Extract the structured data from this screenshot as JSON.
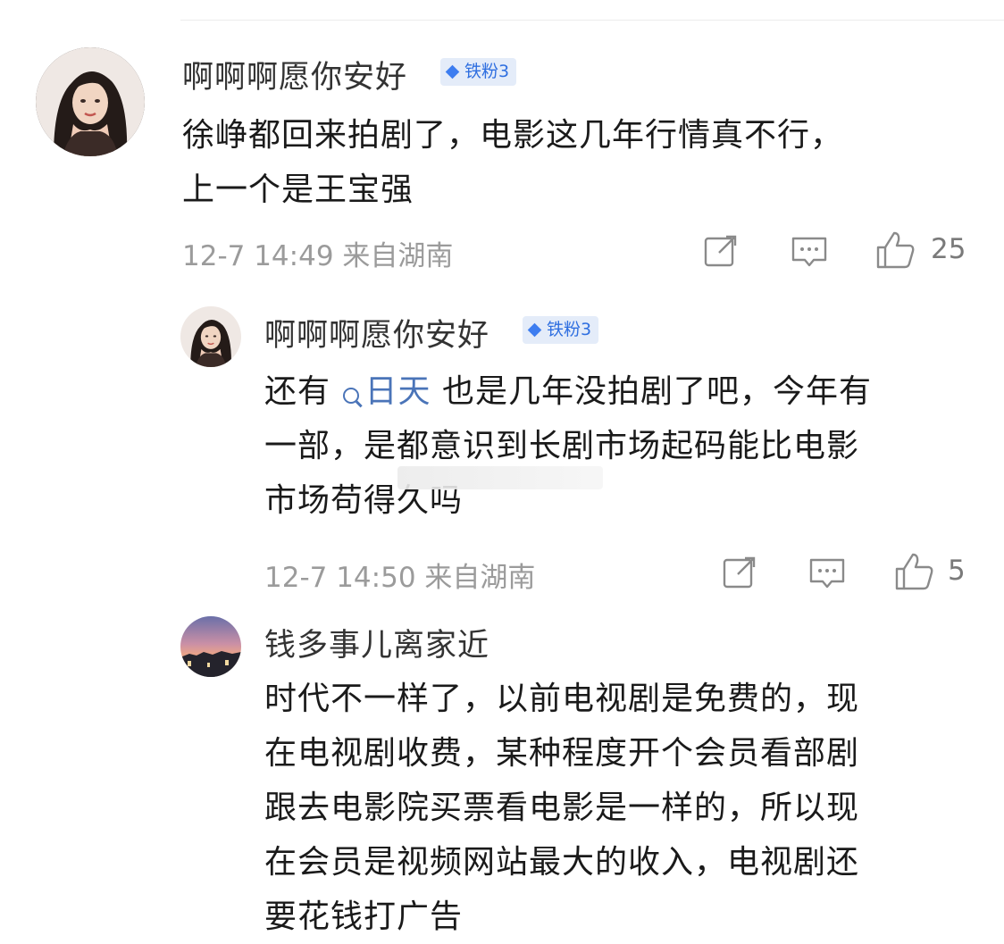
{
  "comments": [
    {
      "username": "啊啊啊愿你安好",
      "badge": "铁粉3",
      "text_lines": [
        "徐峥都回来拍剧了，电影这几年行情真不行，",
        "上一个是王宝强"
      ],
      "meta": "12-7 14:49 来自湖南",
      "likes": "25"
    },
    {
      "username": "啊啊啊愿你安好",
      "badge": "铁粉3",
      "line1_before": "还有",
      "mention": "日天",
      "line1_after": "也是几年没拍剧了吧，今年有",
      "text_lines_rest": [
        "一部，是都意识到长剧市场起码能比电影",
        "市场苟得久吗"
      ],
      "meta": "12-7 14:50 来自湖南",
      "likes": "5"
    },
    {
      "username": "钱多事儿离家近",
      "text_lines": [
        "时代不一样了，以前电视剧是免费的，现",
        "在电视剧收费，某种程度开个会员看部剧",
        "跟去电影院买票看电影是一样的，所以现",
        "在会员是视频网站最大的收入，电视剧还",
        "要花钱打广告"
      ]
    }
  ],
  "icons": {
    "share": "share-icon",
    "comment": "comment-icon",
    "like": "like-icon",
    "badge": "diamond-icon"
  },
  "colors": {
    "badge_bg": "#e4ecf9",
    "badge_text": "#2f6fe0",
    "mention": "#4a74b8",
    "meta": "#9b9b9b"
  }
}
